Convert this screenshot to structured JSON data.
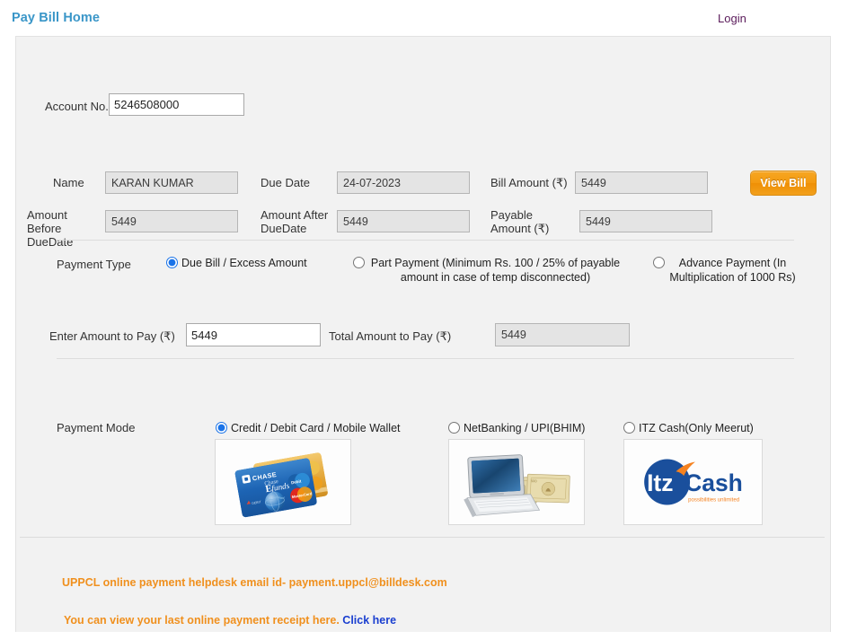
{
  "header": {
    "brand_label": "Pay Bill Home",
    "login_label": "Login",
    "brand_color": "#3a96c8",
    "login_color": "#5a1a5a"
  },
  "account": {
    "label": "Account No.",
    "value": "5246508000",
    "placeholder": ""
  },
  "bill_details": {
    "name_label": "Name",
    "name_value": "KARAN KUMAR",
    "due_date_label": "Due Date",
    "due_date_value": "24-07-2023",
    "bill_amount_label": "Bill Amount (₹)",
    "bill_amount_value": "5449",
    "amount_before_due_label": "Amount Before DueDate",
    "amount_before_due_value": "5449",
    "amount_after_due_label": "Amount After DueDate",
    "amount_after_due_value": "5449",
    "payable_amount_label": "Payable Amount (₹)",
    "payable_amount_value": "5449",
    "view_bill_label": "View Bill",
    "view_bill_color": "#f49a10"
  },
  "payment_type": {
    "label": "Payment Type",
    "options": [
      {
        "label": "Due Bill / Excess Amount",
        "selected": true
      },
      {
        "label": "Part Payment  (Minimum Rs. 100 / 25% of payable amount in case of temp disconnected)",
        "selected": false
      },
      {
        "label": "Advance Payment  (In Multiplication of 1000 Rs)",
        "selected": false
      }
    ]
  },
  "amount_to_pay": {
    "enter_label": "Enter Amount to Pay (₹)",
    "enter_value": "5449",
    "total_label": "Total Amount to Pay (₹)",
    "total_value": "5449"
  },
  "payment_mode": {
    "label": "Payment Mode",
    "options": [
      {
        "label": "Credit / Debit Card / Mobile Wallet",
        "selected": true,
        "image": "credit-card-image"
      },
      {
        "label": "NetBanking / UPI(BHIM)",
        "selected": false,
        "image": "laptop-with-rupee-notes-image"
      },
      {
        "label": "ITZ Cash(Only Meerut)",
        "selected": false,
        "image": "itzcash-logo-image"
      }
    ]
  },
  "card_art": {
    "bank_label": "CHASE",
    "product_label": "E funds"
  },
  "itzcash": {
    "itz_text": "Itz",
    "cash_text": "Cash",
    "tagline": "possibilities unlimited",
    "blue": "#1a4f9c",
    "orange": "#f58220"
  },
  "footer": {
    "helpdesk_text": "UPPCL online payment helpdesk email id- payment.uppcl@billdesk.com",
    "receipt_text": "You can view your last online payment receipt here.",
    "receipt_link_label": "Click here",
    "text_color": "#f0901e",
    "link_color": "#1a3fd0"
  }
}
